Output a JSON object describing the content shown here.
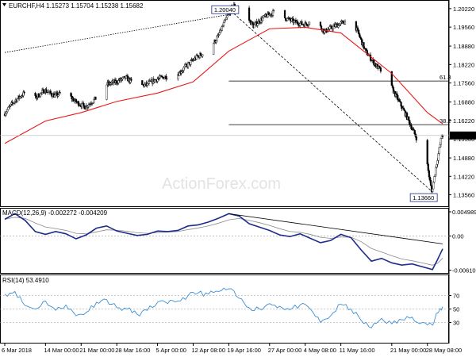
{
  "chart_data": [
    {
      "type": "candlestick",
      "pane": "price",
      "title": "EURCHF,H4  1.15273 1.15704 1.15238 1.15682",
      "symbol": "EURCHF",
      "timeframe": "H4",
      "ohlc_header": {
        "open": 1.15273,
        "high": 1.15704,
        "low": 1.15238,
        "close": 1.15682
      },
      "watermark": "ActionForex.com",
      "ylim": [
        1.1315,
        1.205
      ],
      "y_ticks": [
        "1.20220",
        "1.19560",
        "1.18880",
        "1.18220",
        "1.17560",
        "1.16880",
        "1.16220",
        "1.15560",
        "1.14880",
        "1.14220",
        "1.13560"
      ],
      "y_tick_values": [
        1.2022,
        1.1956,
        1.1888,
        1.1822,
        1.1756,
        1.1688,
        1.1622,
        1.1556,
        1.1488,
        1.1422,
        1.1356
      ],
      "current_price_label": "1.15682",
      "current_price": 1.15682,
      "x_dates": [
        "2018-03-06",
        "2018-03-14",
        "2018-03-21",
        "2018-03-28",
        "2018-04-05",
        "2018-04-12",
        "2018-04-19",
        "2018-04-27",
        "2018-05-04",
        "2018-05-11",
        "2018-05-21",
        "2018-05-28",
        "2018-05-31"
      ],
      "close_path": [
        [
          "2018-03-06",
          1.1645
        ],
        [
          "2018-03-08",
          1.169
        ],
        [
          "2018-03-10",
          1.172
        ],
        [
          "2018-03-12",
          1.17
        ],
        [
          "2018-03-14",
          1.173
        ],
        [
          "2018-03-16",
          1.171
        ],
        [
          "2018-03-18",
          1.1725
        ],
        [
          "2018-03-20",
          1.169
        ],
        [
          "2018-03-22",
          1.167
        ],
        [
          "2018-03-24",
          1.17
        ],
        [
          "2018-03-26",
          1.175
        ],
        [
          "2018-03-28",
          1.176
        ],
        [
          "2018-03-30",
          1.1775
        ],
        [
          "2018-04-01",
          1.1745
        ],
        [
          "2018-04-03",
          1.175
        ],
        [
          "2018-04-05",
          1.177
        ],
        [
          "2018-04-07",
          1.178
        ],
        [
          "2018-04-09",
          1.1785
        ],
        [
          "2018-04-11",
          1.182
        ],
        [
          "2018-04-13",
          1.185
        ],
        [
          "2018-04-15",
          1.187
        ],
        [
          "2018-04-17",
          1.192
        ],
        [
          "2018-04-19",
          1.2
        ],
        [
          "2018-04-20",
          1.2035
        ],
        [
          "2018-04-22",
          1.201
        ],
        [
          "2018-04-24",
          1.196
        ],
        [
          "2018-04-26",
          1.199
        ],
        [
          "2018-04-28",
          1.201
        ],
        [
          "2018-04-30",
          1.199
        ],
        [
          "2018-05-02",
          1.1975
        ],
        [
          "2018-05-04",
          1.1965
        ],
        [
          "2018-05-06",
          1.198
        ],
        [
          "2018-05-08",
          1.194
        ],
        [
          "2018-05-10",
          1.196
        ],
        [
          "2018-05-12",
          1.1975
        ],
        [
          "2018-05-14",
          1.196
        ],
        [
          "2018-05-16",
          1.187
        ],
        [
          "2018-05-18",
          1.182
        ],
        [
          "2018-05-20",
          1.178
        ],
        [
          "2018-05-22",
          1.171
        ],
        [
          "2018-05-24",
          1.164
        ],
        [
          "2018-05-26",
          1.156
        ],
        [
          "2018-05-28",
          1.148
        ],
        [
          "2018-05-29",
          1.1366
        ],
        [
          "2018-05-30",
          1.147
        ],
        [
          "2018-05-31",
          1.15682
        ]
      ],
      "sma_line": [
        [
          "2018-03-06",
          1.154
        ],
        [
          "2018-03-14",
          1.162
        ],
        [
          "2018-03-21",
          1.165
        ],
        [
          "2018-03-28",
          1.169
        ],
        [
          "2018-04-05",
          1.172
        ],
        [
          "2018-04-12",
          1.176
        ],
        [
          "2018-04-19",
          1.187
        ],
        [
          "2018-04-27",
          1.195
        ],
        [
          "2018-05-04",
          1.1955
        ],
        [
          "2018-05-11",
          1.1935
        ],
        [
          "2018-05-21",
          1.179
        ],
        [
          "2018-05-28",
          1.165
        ],
        [
          "2018-05-31",
          1.161
        ]
      ],
      "annotations": [
        {
          "label": "1.20040",
          "date": "2018-04-20",
          "value": 1.2004
        },
        {
          "label": "1.13660",
          "date": "2018-05-29",
          "value": 1.1366
        },
        {
          "label": "61.8",
          "value": 1.1763
        },
        {
          "label": "38.2",
          "value": 1.1607
        }
      ],
      "trendlines": [
        {
          "style": "dotted",
          "from": [
            "2018-03-06",
            1.1865
          ],
          "to": [
            "2018-04-20",
            1.2004
          ]
        },
        {
          "style": "dashed",
          "from": [
            "2018-04-20",
            1.2004
          ],
          "to": [
            "2018-05-29",
            1.1366
          ]
        }
      ]
    },
    {
      "type": "line",
      "pane": "macd",
      "title": "MACD(12,26,9) -0.002272 -0.004209",
      "indicator": "MACD(12,26,9)",
      "values_header": [
        -0.002272,
        -0.004209
      ],
      "ylim": [
        -0.0066,
        0.0049
      ],
      "y_ticks": [
        "0.004989",
        "0.00",
        "-0.006108"
      ],
      "macd_line": [
        [
          "2018-03-06",
          0.003
        ],
        [
          "2018-03-08",
          0.004
        ],
        [
          "2018-03-10",
          0.0028
        ],
        [
          "2018-03-12",
          0.0008
        ],
        [
          "2018-03-14",
          0.0003
        ],
        [
          "2018-03-16",
          0.0008
        ],
        [
          "2018-03-18",
          0.0004
        ],
        [
          "2018-03-20",
          -0.0005
        ],
        [
          "2018-03-22",
          0.0002
        ],
        [
          "2018-03-24",
          0.0014
        ],
        [
          "2018-03-26",
          0.0018
        ],
        [
          "2018-03-28",
          0.0009
        ],
        [
          "2018-03-30",
          0.0005
        ],
        [
          "2018-04-01",
          0.0001
        ],
        [
          "2018-04-03",
          0.0003
        ],
        [
          "2018-04-05",
          0.0009
        ],
        [
          "2018-04-07",
          0.0008
        ],
        [
          "2018-04-09",
          0.001
        ],
        [
          "2018-04-11",
          0.0018
        ],
        [
          "2018-04-13",
          0.002
        ],
        [
          "2018-04-15",
          0.0025
        ],
        [
          "2018-04-17",
          0.0032
        ],
        [
          "2018-04-19",
          0.004
        ],
        [
          "2018-04-21",
          0.0036
        ],
        [
          "2018-04-23",
          0.0022
        ],
        [
          "2018-04-25",
          0.0016
        ],
        [
          "2018-04-27",
          0.001
        ],
        [
          "2018-04-29",
          0.0002
        ],
        [
          "2018-05-01",
          -0.0001
        ],
        [
          "2018-05-03",
          0.0004
        ],
        [
          "2018-05-05",
          -0.0004
        ],
        [
          "2018-05-07",
          -0.0012
        ],
        [
          "2018-05-09",
          -0.0008
        ],
        [
          "2018-05-11",
          0.0003
        ],
        [
          "2018-05-13",
          -0.0003
        ],
        [
          "2018-05-15",
          -0.0025
        ],
        [
          "2018-05-17",
          -0.0045
        ],
        [
          "2018-05-19",
          -0.004
        ],
        [
          "2018-05-21",
          -0.0048
        ],
        [
          "2018-05-23",
          -0.0052
        ],
        [
          "2018-05-25",
          -0.005
        ],
        [
          "2018-05-27",
          -0.0055
        ],
        [
          "2018-05-29",
          -0.006
        ],
        [
          "2018-05-30",
          -0.0042
        ],
        [
          "2018-05-31",
          -0.0023
        ]
      ],
      "trendline": {
        "from": [
          "2018-04-19",
          0.004
        ],
        "to": [
          "2018-05-31",
          -0.0014
        ]
      }
    },
    {
      "type": "line",
      "pane": "rsi",
      "title": "RSI(14) 53.4910",
      "indicator": "RSI(14)",
      "value_header": 53.491,
      "ylim": [
        0,
        100
      ],
      "y_ticks": [
        "70",
        "50",
        "30"
      ],
      "levels": [
        70,
        50,
        30
      ],
      "rsi_line": [
        [
          "2018-03-06",
          72
        ],
        [
          "2018-03-08",
          76
        ],
        [
          "2018-03-10",
          55
        ],
        [
          "2018-03-12",
          50
        ],
        [
          "2018-03-14",
          62
        ],
        [
          "2018-03-16",
          48
        ],
        [
          "2018-03-18",
          56
        ],
        [
          "2018-03-20",
          40
        ],
        [
          "2018-03-22",
          45
        ],
        [
          "2018-03-24",
          60
        ],
        [
          "2018-03-26",
          64
        ],
        [
          "2018-03-28",
          52
        ],
        [
          "2018-03-30",
          50
        ],
        [
          "2018-04-01",
          42
        ],
        [
          "2018-04-03",
          48
        ],
        [
          "2018-04-05",
          60
        ],
        [
          "2018-04-07",
          58
        ],
        [
          "2018-04-09",
          62
        ],
        [
          "2018-04-11",
          70
        ],
        [
          "2018-04-13",
          74
        ],
        [
          "2018-04-15",
          72
        ],
        [
          "2018-04-17",
          76
        ],
        [
          "2018-04-19",
          80
        ],
        [
          "2018-04-21",
          66
        ],
        [
          "2018-04-23",
          52
        ],
        [
          "2018-04-25",
          50
        ],
        [
          "2018-04-27",
          58
        ],
        [
          "2018-04-29",
          54
        ],
        [
          "2018-05-01",
          49
        ],
        [
          "2018-05-03",
          56
        ],
        [
          "2018-05-05",
          50
        ],
        [
          "2018-05-07",
          30
        ],
        [
          "2018-05-09",
          40
        ],
        [
          "2018-05-11",
          57
        ],
        [
          "2018-05-13",
          50
        ],
        [
          "2018-05-15",
          33
        ],
        [
          "2018-05-17",
          22
        ],
        [
          "2018-05-19",
          36
        ],
        [
          "2018-05-21",
          28
        ],
        [
          "2018-05-23",
          34
        ],
        [
          "2018-05-25",
          38
        ],
        [
          "2018-05-27",
          30
        ],
        [
          "2018-05-29",
          26
        ],
        [
          "2018-05-30",
          44
        ],
        [
          "2018-05-31",
          53.49
        ]
      ]
    }
  ],
  "x_axis_labels": [
    "6 Mar 2018",
    "14 Mar 00:00",
    "21 Mar 00:00",
    "28 Mar 16:00",
    "5 Apr 00:00",
    "12 Apr 08:00",
    "19 Apr 16:00",
    "27 Apr 00:00",
    "4 May 08:00",
    "11 May 16:00",
    "21 May 00:00",
    "28 May 08:00"
  ],
  "x_axis_dates": [
    "2018-03-06",
    "2018-03-14",
    "2018-03-21",
    "2018-03-28",
    "2018-04-05",
    "2018-04-12",
    "2018-04-19",
    "2018-04-27",
    "2018-05-04",
    "2018-05-11",
    "2018-05-21",
    "2018-05-28"
  ],
  "colors": {
    "candle_up": "#ffffff",
    "candle_down": "#000000",
    "candle_border": "#000000",
    "sma": "#e8191a",
    "macd": "#1d2b8c",
    "rsi": "#3b8fd6",
    "trendline": "#000000",
    "annotation_border": "#1d2b8c",
    "current_price_bg": "#000000"
  }
}
